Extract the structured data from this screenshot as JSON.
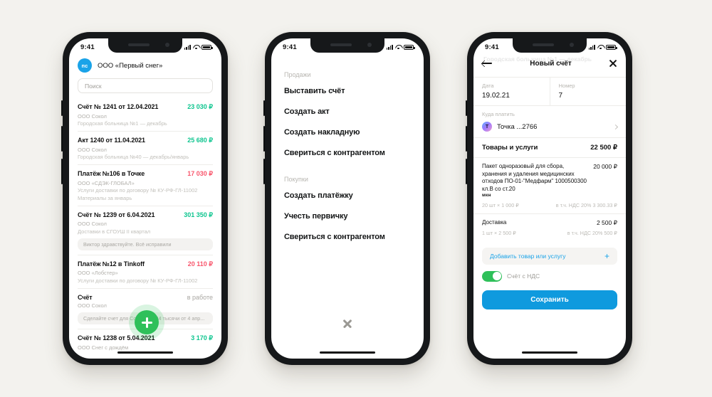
{
  "status_bar": {
    "time": "9:41"
  },
  "phone1": {
    "header": {
      "avatar_initials": "пс",
      "org_name": "ООО «Первый снег»"
    },
    "search": {
      "placeholder": "Поиск"
    },
    "documents": [
      {
        "title": "Счёт № 1241 от 12.04.2021",
        "amount": "23 030 ₽",
        "amount_color": "green",
        "counterparty": "ООО Сокол",
        "description": "Городская больница №1 — декабрь",
        "bubble": ""
      },
      {
        "title": "Акт 1240 от 11.04.2021",
        "amount": "25 680 ₽",
        "amount_color": "green",
        "counterparty": "ООО Сокол",
        "description": "Городская больница №40 — декабрь/январь",
        "bubble": ""
      },
      {
        "title": "Платёж №106 в Точке",
        "amount": "17 030 ₽",
        "amount_color": "red",
        "counterparty": "ООО «СДЭК-ГЛОБАЛ»",
        "description": "Услуги доставки по договору № КУ-РФ-ГЛ-11002",
        "description2": "Материалы за январь",
        "bubble": ""
      },
      {
        "title": "Счёт № 1239 от 6.04.2021",
        "amount": "301 350 ₽",
        "amount_color": "green",
        "counterparty": "ООО Сокол",
        "description": "Доставки в СГОУШ II квартал",
        "bubble": "Виктор здравствуйте. Всё исправили"
      },
      {
        "title": "Платёж №12 в Tinkoff",
        "amount": "20 110 ₽",
        "amount_color": "red",
        "counterparty": "ООО «Лобстер»",
        "description": "Услуги доставки по договору № КУ-РФ-ГЛ-11002",
        "bubble": ""
      },
      {
        "title": "Счёт",
        "amount": "в работе",
        "amount_color": "grey",
        "counterparty": "ООО Сокол",
        "description": "",
        "bubble": "Сделайте счет для Сокол на 234 тысячи от 4 апр..."
      },
      {
        "title": "Счёт № 1238 от 5.04.2021",
        "amount": "3 170 ₽",
        "amount_color": "green",
        "counterparty": "ООО Снег с дождём",
        "description": "",
        "bubble": ""
      }
    ],
    "fab": {
      "icon": "plus-icon"
    }
  },
  "phone2": {
    "groups": [
      {
        "label": "Продажи",
        "items": [
          "Выставить счёт",
          "Создать акт",
          "Создать накладную",
          "Свериться с контрагентом"
        ]
      },
      {
        "label": "Покупки",
        "items": [
          "Создать платёжку",
          "Учесть первичку",
          "Свериться с контрагентом"
        ]
      }
    ],
    "close_icon": "close-icon"
  },
  "phone3": {
    "ghost": {
      "line1": "Городская больница №1 — декабрь",
      "line2": ""
    },
    "header": {
      "back_icon": "back-arrow-icon",
      "title": "Новый счёт",
      "close_icon": "close-icon"
    },
    "date_field": {
      "label": "Дата",
      "value": "19.02.21"
    },
    "number_field": {
      "label": "Номер",
      "value": "7"
    },
    "payment": {
      "label": "Куда платить",
      "avatar_letter": "Т",
      "account": "Точка ...2766"
    },
    "items_section": {
      "title": "Товары и услуги",
      "total": "22 500 ₽"
    },
    "items": [
      {
        "name": "Пакет одноразовый для сбора, хранения и удаления медицинских отходов ПО-01-\"Медфарм\" 1000500300 кл.В со ст.20",
        "unit": "мкн",
        "price": "20 000 ₽",
        "qty_line": "20 шт × 1 000 ₽",
        "vat_line": "в т.ч. НДС 20% 3 300.33 ₽"
      },
      {
        "name": "Доставка",
        "unit": "",
        "price": "2 500 ₽",
        "qty_line": "1 шт × 2 500 ₽",
        "vat_line": "в т.ч. НДС 20% 500 ₽"
      }
    ],
    "add_item": {
      "label": "Добавить товар или услугу",
      "plus": "+"
    },
    "vat_toggle": {
      "label": "Счёт с  НДС",
      "enabled": true
    },
    "save_button": {
      "label": "Сохранить"
    }
  },
  "colors": {
    "background": "#f3f2ee",
    "accent_blue": "#0f9ade",
    "green": "#0ec58f",
    "red": "#f8566c",
    "fab_green": "#2fc05a"
  }
}
